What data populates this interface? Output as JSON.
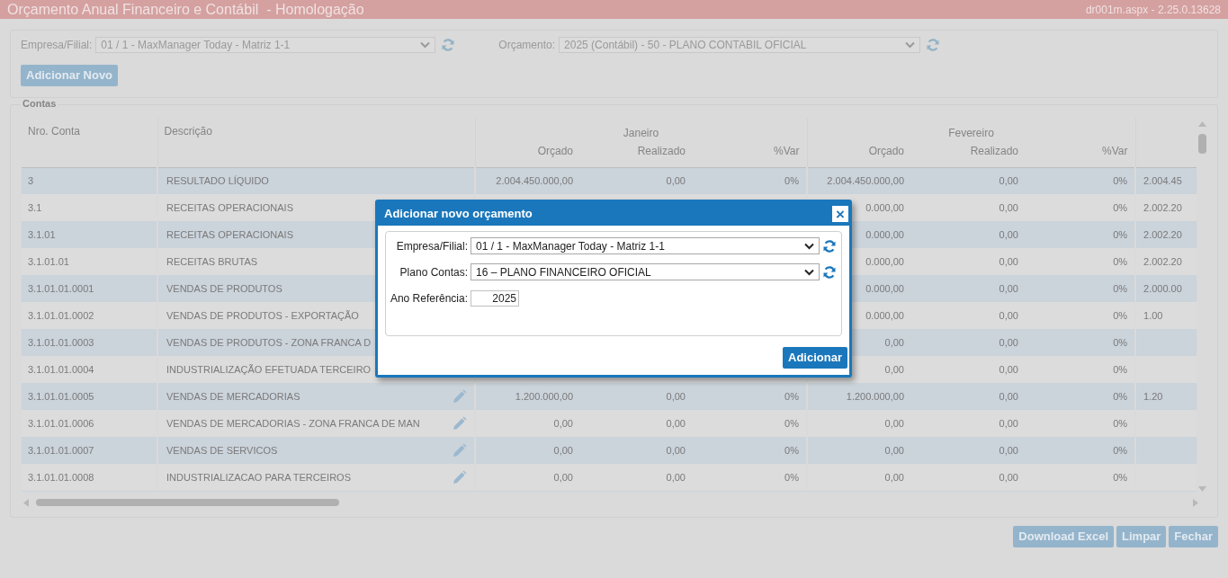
{
  "window": {
    "title": "Orçamento Anual Financeiro e Contábil  - Homologação",
    "file_info": "dr001m.aspx - 2.25.0.13628"
  },
  "filters": [
    {
      "label": "Empresa/Filial:",
      "value": "01 / 1 - MaxManager Today - Matriz 1-1"
    },
    {
      "label": "Orçamento:",
      "value": "2025 (Contábil) - 50 - PLANO CONTABIL OFICIAL"
    }
  ],
  "add_button": "Adicionar Novo",
  "section_title": "Contas",
  "table": {
    "columns": [
      "Nro. Conta",
      "Descrição"
    ],
    "groups": [
      {
        "name": "Janeiro",
        "columns": [
          "Orçado",
          "Realizado",
          "%Var"
        ]
      },
      {
        "name": "Fevereiro",
        "columns": [
          "Orçado",
          "Realizado",
          "%Var"
        ]
      }
    ],
    "rows": [
      {
        "account": "3",
        "description": "RESULTADO LÍQUIDO",
        "editable": false,
        "jan_orcado": "2.004.450.000,00",
        "jan_realizado": "0,00",
        "jan_var": "0%",
        "fev_orcado": "2.004.450.000,00",
        "fev_realizado": "0,00",
        "fev_var": "0%",
        "column_9": "2.004.45"
      },
      {
        "account": "3.1",
        "description": "RECEITAS OPERACIONAIS",
        "fev_orcado": "0.000,00",
        "fev_realizado": "0,00",
        "fev_var": "0%",
        "column_9": "2.002.20"
      },
      {
        "account": "3.1.01",
        "description": "RECEITAS OPERACIONAIS",
        "fev_orcado": "0.000,00",
        "fev_realizado": "0,00",
        "fev_var": "0%",
        "column_9": "2.002.20"
      },
      {
        "account": "3.1.01.01",
        "description": "RECEITAS BRUTAS",
        "fev_orcado": "0.000,00",
        "fev_realizado": "0,00",
        "fev_var": "0%",
        "column_9": "2.002.20"
      },
      {
        "account": "3.1.01.01.0001",
        "description": "VENDAS DE PRODUTOS",
        "fev_orcado": "0.000,00",
        "fev_realizado": "0,00",
        "fev_var": "0%",
        "column_9": "2.000.00"
      },
      {
        "account": "3.1.01.01.0002",
        "description": "VENDAS DE PRODUTOS - EXPORTAÇÃO",
        "fev_orcado": "0.000,00",
        "fev_realizado": "0,00",
        "fev_var": "0%",
        "column_9": "1.00"
      },
      {
        "account": "3.1.01.01.0003",
        "description": "VENDAS DE PRODUTOS - ZONA FRANCA D",
        "fev_orcado": "0,00",
        "fev_realizado": "0,00",
        "fev_var": "0%"
      },
      {
        "account": "3.1.01.01.0004",
        "description": "INDUSTRIALIZAÇÃO EFETUADA TERCEIRO",
        "fev_orcado": "0,00",
        "fev_realizado": "0,00",
        "fev_var": "0%"
      },
      {
        "account": "3.1.01.01.0005",
        "description": "VENDAS DE MERCADORIAS",
        "editable": true,
        "jan_orcado": "1.200.000,00",
        "jan_realizado": "0,00",
        "jan_var": "0%",
        "fev_orcado": "1.200.000,00",
        "fev_realizado": "0,00",
        "fev_var": "0%",
        "column_9": "1.20"
      },
      {
        "account": "3.1.01.01.0006",
        "description": "VENDAS DE MERCADORIAS - ZONA FRANCA DE MAN",
        "editable": true,
        "jan_orcado": "0,00",
        "jan_realizado": "0,00",
        "jan_var": "0%",
        "fev_orcado": "0,00",
        "fev_realizado": "0,00",
        "fev_var": "0%"
      },
      {
        "account": "3.1.01.01.0007",
        "description": "VENDAS DE SERVICOS",
        "editable": true,
        "jan_orcado": "0,00",
        "jan_realizado": "0,00",
        "jan_var": "0%",
        "fev_orcado": "0,00",
        "fev_realizado": "0,00",
        "fev_var": "0%"
      },
      {
        "account": "3.1.01.01.0008",
        "description": "INDUSTRIALIZACAO PARA TERCEIROS",
        "editable": true,
        "jan_orcado": "0,00",
        "jan_realizado": "0,00",
        "jan_var": "0%",
        "fev_orcado": "0,00",
        "fev_realizado": "0,00",
        "fev_var": "0%"
      }
    ]
  },
  "footer_buttons": [
    "Download Excel",
    "Limpar",
    "Fechar"
  ],
  "dialog": {
    "title": "Adicionar novo orçamento",
    "close": "×",
    "fields": [
      {
        "kind": "select",
        "label": "Empresa/Filial:",
        "value": "01 / 1 - MaxManager Today - Matriz 1-1"
      },
      {
        "kind": "select",
        "label": "Plano Contas:",
        "value": "16 – PLANO FINANCEIRO OFICIAL"
      },
      {
        "kind": "text",
        "label": "Ano Referência:",
        "value": "2025"
      }
    ],
    "button": "Adicionar"
  }
}
